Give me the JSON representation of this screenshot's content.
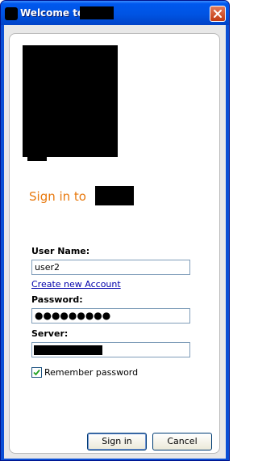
{
  "window": {
    "title": "Welcome to",
    "close_icon": "close-icon"
  },
  "login": {
    "heading": "Sign in to",
    "username_label": "User Name:",
    "username_value": "user2",
    "create_account_link": "Create new Account",
    "password_label": "Password:",
    "password_value": "●●●●●●●●●",
    "server_label": "Server:",
    "remember_label": "Remember password",
    "remember_checked": true
  },
  "buttons": {
    "signin_label": "Sign in",
    "cancel_label": "Cancel"
  },
  "colors": {
    "titlebar": "#0054e3",
    "heading": "#e8790e",
    "link": "#0000aa"
  }
}
